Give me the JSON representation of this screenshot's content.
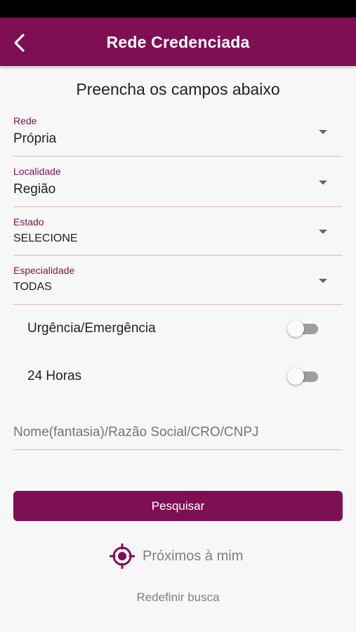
{
  "app_bar": {
    "title": "Rede Credenciada",
    "back_icon": "chevron-left-icon"
  },
  "form": {
    "title": "Preencha os campos abaixo",
    "fields": [
      {
        "label": "Rede",
        "value": "Própria"
      },
      {
        "label": "Localidade",
        "value": "Região"
      },
      {
        "label": "Estado",
        "value": "SELECIONE"
      },
      {
        "label": "Especialidade",
        "value": "TODAS"
      }
    ],
    "toggles": [
      {
        "label": "Urgência/Emergência",
        "on": false
      },
      {
        "label": "24 Horas",
        "on": false
      }
    ],
    "name_search": {
      "placeholder": "Nome(fantasia)/Razão Social/CRO/CNPJ",
      "value": ""
    },
    "search_button": "Pesquisar",
    "nearby": {
      "label": "Próximos à mim",
      "icon": "location-target-icon"
    },
    "reset_link": "Redefinir busca"
  },
  "colors": {
    "primary": "#7e0f55",
    "background": "#f7f7f7",
    "muted_text": "#808080"
  }
}
